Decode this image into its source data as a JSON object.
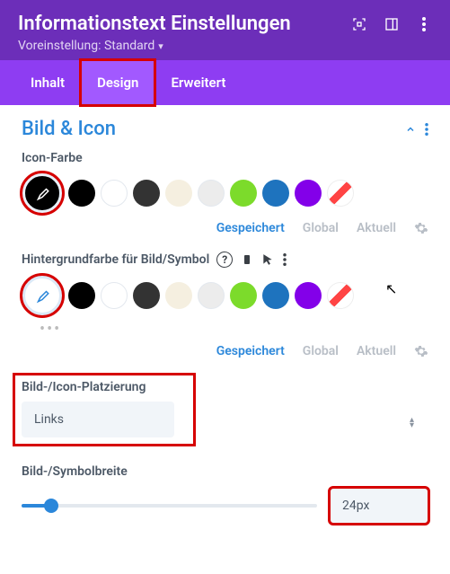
{
  "header": {
    "title": "Informationstext Einstellungen",
    "preset": "Voreinstellung: Standard"
  },
  "tabs": {
    "content": "Inhalt",
    "design": "Design",
    "advanced": "Erweitert"
  },
  "section": {
    "title": "Bild & Icon"
  },
  "icon_color": {
    "label": "Icon-Farbe",
    "palette": [
      "#000000",
      "#ffffff",
      "#333333",
      "#f5efe0",
      "#ececec",
      "#7cdb2b",
      "#1e73be",
      "#8300e9"
    ]
  },
  "bg_color": {
    "label": "Hintergrundfarbe für Bild/Symbol",
    "palette": [
      "#000000",
      "#ffffff",
      "#333333",
      "#f5efe0",
      "#ececec",
      "#7cdb2b",
      "#1e73be",
      "#8300e9"
    ]
  },
  "status": {
    "saved": "Gespeichert",
    "global": "Global",
    "current": "Aktuell"
  },
  "placement": {
    "label": "Bild-/Icon-Platzierung",
    "value": "Links"
  },
  "width": {
    "label": "Bild-/Symbolbreite",
    "value": "24px"
  }
}
